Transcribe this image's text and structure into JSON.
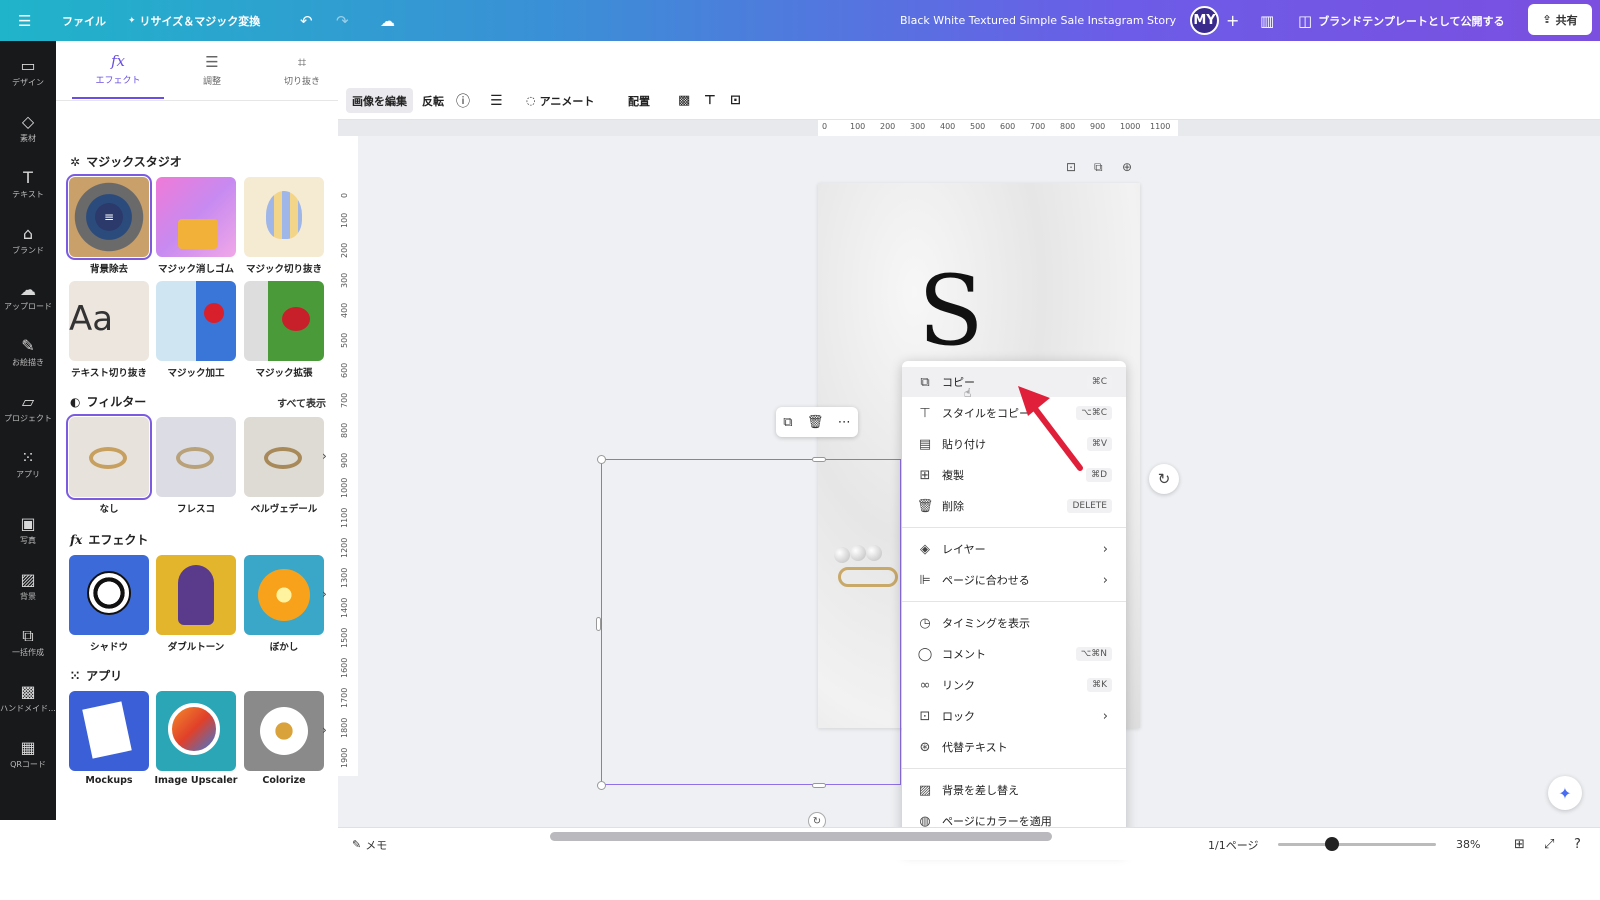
{
  "topbar": {
    "menu_icon": "hamburger-icon",
    "file": "ファイル",
    "resize": "リサイズ＆マジック変換",
    "title": "Black White Textured Simple Sale Instagram Story",
    "avatar": "MY",
    "plus": "+",
    "publish": "ブランドテンプレートとして公開する",
    "share": "共有"
  },
  "rail": [
    {
      "label": "デザイン",
      "icon": "design-icon"
    },
    {
      "label": "素材",
      "icon": "elements-icon"
    },
    {
      "label": "テキスト",
      "icon": "text-icon"
    },
    {
      "label": "ブランド",
      "icon": "brand-icon"
    },
    {
      "label": "アップロード",
      "icon": "upload-icon"
    },
    {
      "label": "お絵描き",
      "icon": "draw-icon"
    },
    {
      "label": "プロジェクト",
      "icon": "projects-icon"
    },
    {
      "label": "アプリ",
      "icon": "apps-icon"
    },
    {
      "label": "写真",
      "icon": "photos-icon"
    },
    {
      "label": "背景",
      "icon": "background-icon"
    },
    {
      "label": "一括作成",
      "icon": "bulk-create-icon"
    },
    {
      "label": "ハンドメイド...",
      "icon": "handmade-icon"
    },
    {
      "label": "QRコード",
      "icon": "qr-code-icon"
    }
  ],
  "panel": {
    "tabs": [
      {
        "label": "エフェクト",
        "icon": "fx-icon"
      },
      {
        "label": "調整",
        "icon": "adjust-icon"
      },
      {
        "label": "切り抜き",
        "icon": "crop-icon"
      }
    ],
    "magic_studio": {
      "title": "マジックスタジオ",
      "items": [
        "背景除去",
        "マジック消しゴム",
        "マジック切り抜き",
        "テキスト切り抜き",
        "マジック加工",
        "マジック拡張"
      ]
    },
    "filters": {
      "title": "フィルター",
      "see_all": "すべて表示",
      "items": [
        "なし",
        "フレスコ",
        "ベルヴェデール"
      ]
    },
    "effects": {
      "title": "エフェクト",
      "items": [
        "シャドウ",
        "ダブルトーン",
        "ぼかし"
      ]
    },
    "apps": {
      "title": "アプリ",
      "items": [
        "Mockups",
        "Image Upscaler",
        "Colorize"
      ]
    }
  },
  "toolbar": {
    "edit_image": "画像を編集",
    "flip": "反転",
    "animate": "アニメート",
    "position": "配置"
  },
  "ruler": {
    "h": [
      "0",
      "100",
      "200",
      "300",
      "400",
      "500",
      "600",
      "700",
      "800",
      "900",
      "1000",
      "1100"
    ],
    "v": [
      "0",
      "100",
      "200",
      "300",
      "400",
      "500",
      "600",
      "700",
      "800",
      "900",
      "1000",
      "1100",
      "1200",
      "1300",
      "1400",
      "1500",
      "1600",
      "1700",
      "1800",
      "1900"
    ]
  },
  "canvas": {
    "big_letter": "S"
  },
  "context_menu": [
    {
      "label": "コピー",
      "shortcut": "⌘C",
      "icon": "copy-icon"
    },
    {
      "label": "スタイルをコピー",
      "shortcut": "⌥⌘C",
      "icon": "paint-roller-icon"
    },
    {
      "label": "貼り付け",
      "shortcut": "⌘V",
      "icon": "clipboard-icon"
    },
    {
      "label": "複製",
      "shortcut": "⌘D",
      "icon": "duplicate-icon"
    },
    {
      "label": "削除",
      "shortcut": "DELETE",
      "icon": "trash-icon"
    },
    {
      "label": "レイヤー",
      "icon": "layers-icon"
    },
    {
      "label": "ページに合わせる",
      "icon": "align-icon"
    },
    {
      "label": "タイミングを表示",
      "icon": "clock-icon"
    },
    {
      "label": "コメント",
      "shortcut": "⌥⌘N",
      "icon": "comment-icon"
    },
    {
      "label": "リンク",
      "shortcut": "⌘K",
      "icon": "link-icon"
    },
    {
      "label": "ロック",
      "icon": "lock-icon"
    },
    {
      "label": "代替テキスト",
      "icon": "accessibility-icon"
    },
    {
      "label": "背景を差し替え",
      "icon": "background-replace-icon"
    },
    {
      "label": "ページにカラーを適用",
      "icon": "page-color-icon"
    }
  ],
  "bottom": {
    "notes": "メモ",
    "pages": "1/1ページ",
    "zoom": "38%",
    "zoom_level": 0.38
  },
  "colors": {
    "accent": "#7b5ce0",
    "arrow": "#e0203a"
  }
}
